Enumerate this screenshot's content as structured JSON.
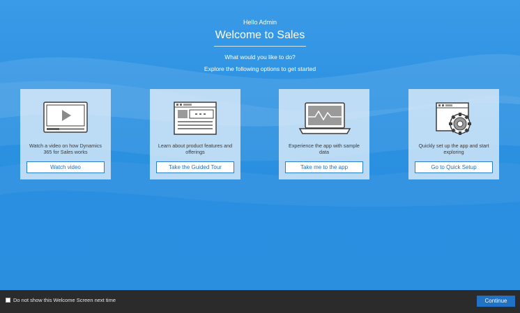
{
  "header": {
    "greeting": "Hello Admin",
    "title": "Welcome to Sales",
    "question": "What would you like to do?",
    "subtitle": "Explore the following options to get started"
  },
  "cards": [
    {
      "icon": "video-player-icon",
      "description": "Watch a video on how Dynamics 365 for Sales works",
      "button": "Watch video"
    },
    {
      "icon": "web-page-icon",
      "description": "Learn about product features and offerings",
      "button": "Take the Guided Tour"
    },
    {
      "icon": "laptop-chart-icon",
      "description": "Experience the app with sample data",
      "button": "Take me to the app"
    },
    {
      "icon": "settings-gear-icon",
      "description": "Quickly set up the app and start exploring",
      "button": "Go to Quick Setup"
    }
  ],
  "footer": {
    "checkbox_label": "Do not show this Welcome Screen next time",
    "checkbox_checked": false,
    "continue_label": "Continue"
  },
  "colors": {
    "background": "#2f96e6",
    "footer": "#2b2b2b",
    "accent": "#1f72c6"
  }
}
